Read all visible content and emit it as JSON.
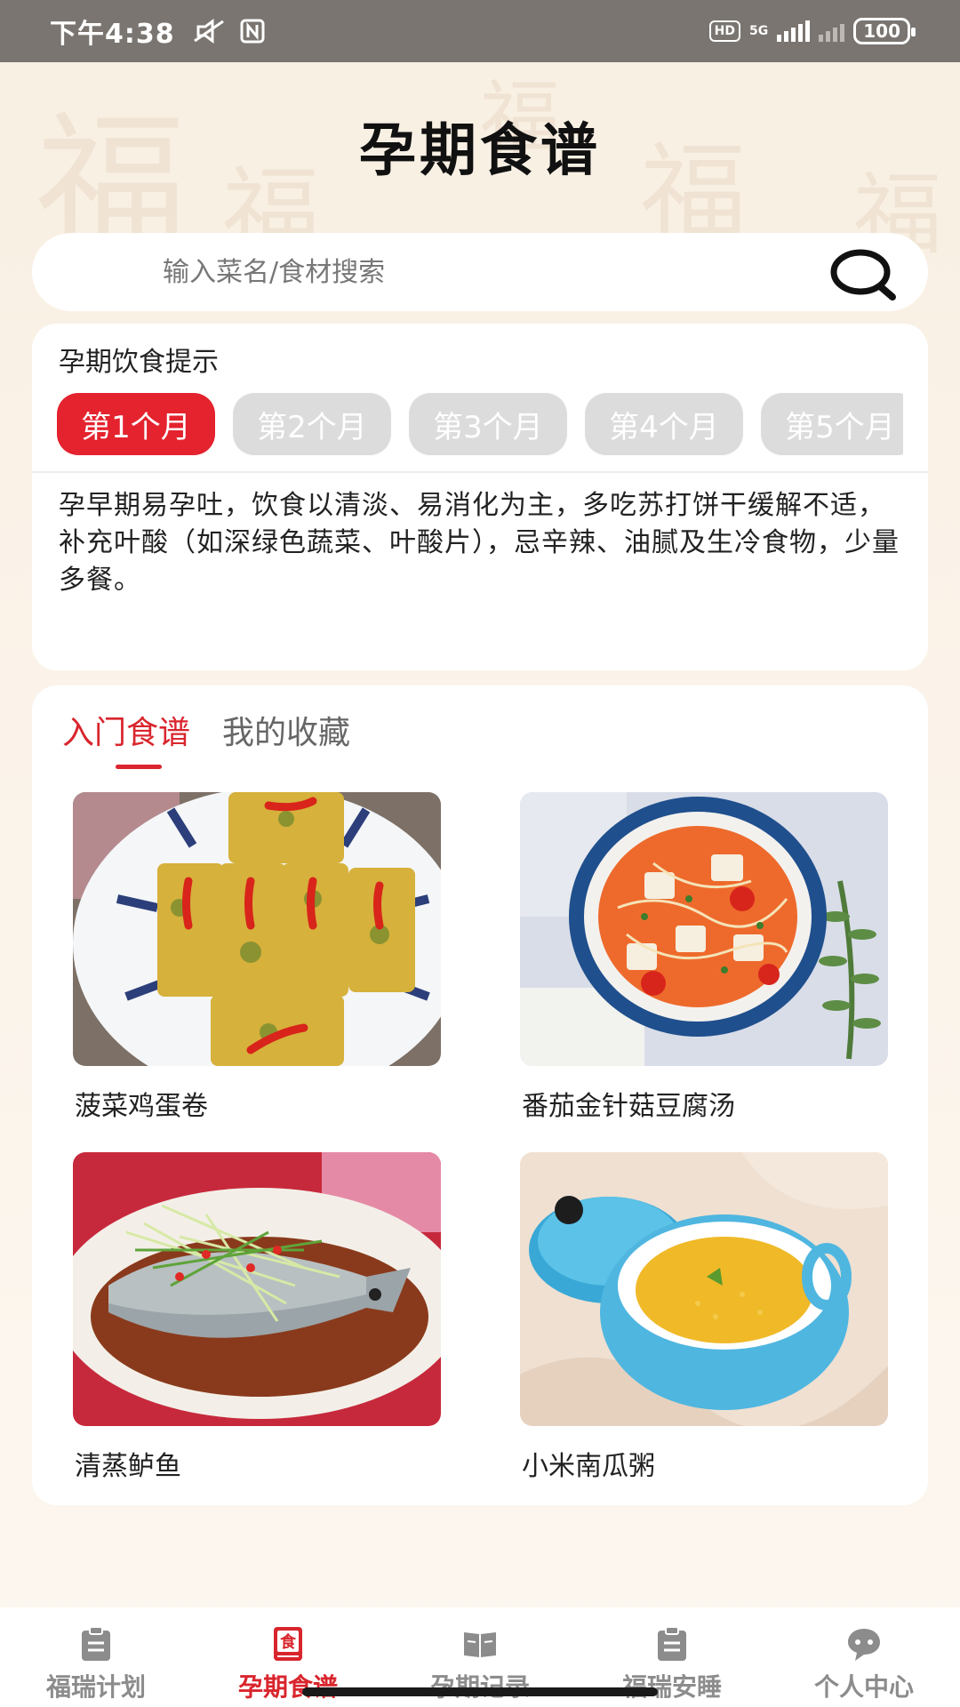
{
  "status_bar": {
    "time": "下午4:38",
    "hd": "HD",
    "network": "5G",
    "battery": "100"
  },
  "page": {
    "title": "孕期食谱"
  },
  "search": {
    "placeholder": "输入菜名/食材搜索"
  },
  "tips": {
    "title": "孕期饮食提示",
    "months": [
      "第1个月",
      "第2个月",
      "第3个月",
      "第4个月",
      "第5个月"
    ],
    "active_month_index": 0,
    "text": "孕早期易孕吐，饮食以清淡、易消化为主，多吃苏打饼干缓解不适，补充叶酸（如深绿色蔬菜、叶酸片），忌辛辣、油腻及生冷食物，少量多餐。"
  },
  "recipes": {
    "tabs": [
      "入门食谱",
      "我的收藏"
    ],
    "active_tab_index": 0,
    "items": [
      {
        "name": "菠菜鸡蛋卷"
      },
      {
        "name": "番茄金针菇豆腐汤"
      },
      {
        "name": "清蒸鲈鱼"
      },
      {
        "name": "小米南瓜粥"
      }
    ]
  },
  "bottom_nav": {
    "items": [
      {
        "label": "福瑞计划",
        "icon": "clipboard-icon"
      },
      {
        "label": "孕期食谱",
        "icon": "recipe-book-icon"
      },
      {
        "label": "孕期记录",
        "icon": "open-book-icon"
      },
      {
        "label": "福瑞安睡",
        "icon": "clipboard-icon"
      },
      {
        "label": "个人中心",
        "icon": "chat-bubble-icon"
      }
    ],
    "active_index": 1
  },
  "colors": {
    "accent": "#e4232e",
    "background": "#f8efe2",
    "inactive_tab": "#dcdcdc",
    "nav_inactive": "#8c8c8c"
  }
}
